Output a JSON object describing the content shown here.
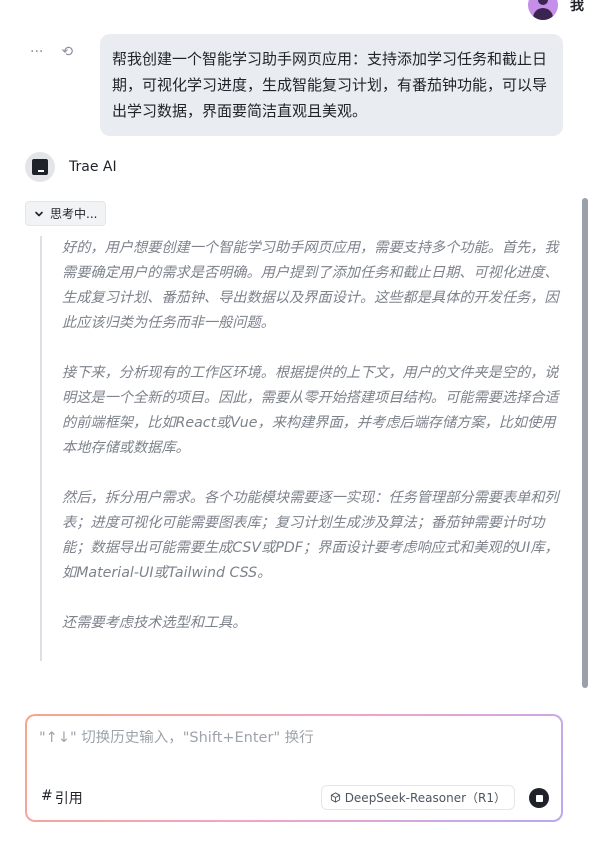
{
  "user": {
    "name": "我"
  },
  "message_actions": {
    "more_glyph": "···",
    "retry_glyph": "⟲"
  },
  "user_message": "帮我创建一个智能学习助手网页应用：支持添加学习任务和截止日期，可视化学习进度，生成智能复习计划，有番茄钟功能，可以导出学习数据，界面要简洁直观且美观。",
  "assistant": {
    "name": "Trae AI",
    "thinking_label": "思考中...",
    "thoughts": [
      "好的，用户想要创建一个智能学习助手网页应用，需要支持多个功能。首先，我需要确定用户的需求是否明确。用户提到了添加任务和截止日期、可视化进度、生成复习计划、番茄钟、导出数据以及界面设计。这些都是具体的开发任务，因此应该归类为任务而非一般问题。",
      "接下来，分析现有的工作区环境。根据提供的上下文，用户的文件夹是空的，说明这是一个全新的项目。因此，需要从零开始搭建项目结构。可能需要选择合适的前端框架，比如React或Vue，来构建界面，并考虑后端存储方案，比如使用本地存储或数据库。",
      "然后，拆分用户需求。各个功能模块需要逐一实现：任务管理部分需要表单和列表；进度可视化可能需要图表库；复习计划生成涉及算法；番茄钟需要计时功能；数据导出可能需要生成CSV或PDF；界面设计要考虑响应式和美观的UI库，如Material-UI或Tailwind CSS。",
      "还需要考虑技术选型和工具。"
    ]
  },
  "composer": {
    "placeholder": "\"↑↓\" 切换历史输入，\"Shift+Enter\" 换行",
    "cite_hash": "#",
    "cite_label": "引用",
    "model_label": "DeepSeek-Reasoner（R1）"
  },
  "icons": {
    "more": "ellipsis-icon",
    "retry": "retry-icon",
    "chevron": "chevron-down-icon",
    "model": "cube-icon",
    "stop": "stop-icon"
  }
}
